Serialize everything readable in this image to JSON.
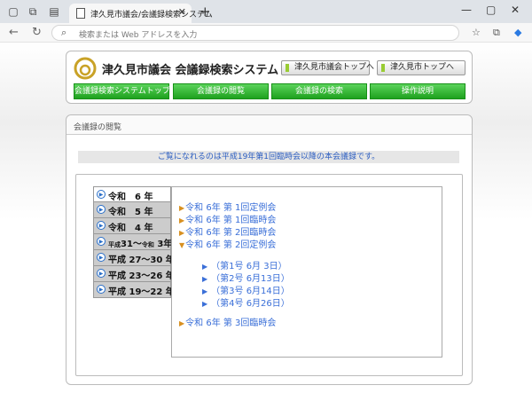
{
  "browser": {
    "tab_title": "津久見市議会/会議録検索システム",
    "address_placeholder": "検索または Web アドレスを入力"
  },
  "header": {
    "site_title": "津久見市議会 会議録検索システム",
    "btn_council_top": "津久見市議会トップへ",
    "btn_city_top": "津久見市トップへ"
  },
  "nav": [
    {
      "label": "会議録検索システムトップ"
    },
    {
      "label": "会議録の閲覧"
    },
    {
      "label": "会議録の検索"
    },
    {
      "label": "操作説明"
    }
  ],
  "panel": {
    "title": "会議録の閲覧",
    "notice": "ご覧になれるのは平成19年第1回臨時会以降の本会議録です。"
  },
  "eras": [
    {
      "label": "令和　6 年"
    },
    {
      "label": "令和　5 年"
    },
    {
      "label": "令和　4 年"
    },
    {
      "label_a": "平成",
      "label_b": "31～",
      "label_c": "令和",
      "label_d": " 3年"
    },
    {
      "label": "平成 27～30 年"
    },
    {
      "label": "平成 23～26 年"
    },
    {
      "label": "平成 19～22 年"
    }
  ],
  "sessions": [
    {
      "label": "令和 6年 第 1回定例会"
    },
    {
      "label": "令和 6年 第 1回臨時会"
    },
    {
      "label": "令和 6年 第 2回臨時会"
    },
    {
      "label": "令和 6年 第 2回定例会"
    },
    {
      "label": "令和 6年 第 3回臨時会"
    }
  ],
  "subs": [
    {
      "label": "（第1号 6月 3日）"
    },
    {
      "label": "（第2号 6月13日）"
    },
    {
      "label": "（第3号 6月14日）"
    },
    {
      "label": "（第4号 6月26日）"
    }
  ],
  "colors": {
    "nav_green": "#1ea11e",
    "link_blue": "#3a6fd8",
    "accent_orange": "#d89020"
  }
}
